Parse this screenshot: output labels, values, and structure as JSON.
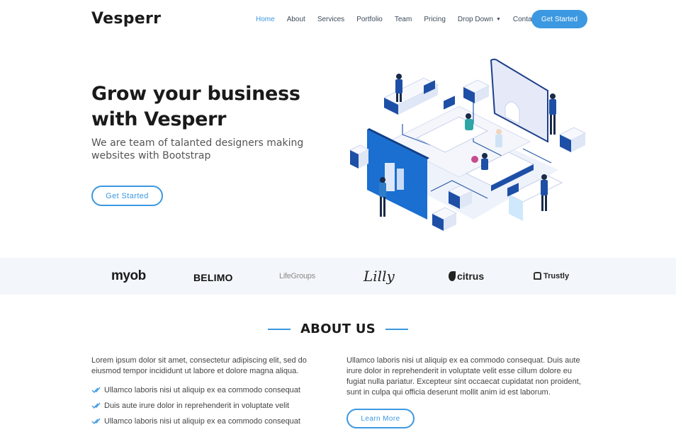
{
  "brand": {
    "name": "Vesperr"
  },
  "nav": {
    "items": [
      {
        "label": "Home",
        "active": true
      },
      {
        "label": "About"
      },
      {
        "label": "Services"
      },
      {
        "label": "Portfolio"
      },
      {
        "label": "Team"
      },
      {
        "label": "Pricing"
      },
      {
        "label": "Drop Down",
        "has_dropdown": true
      },
      {
        "label": "Contact"
      }
    ],
    "cta_label": "Get Started"
  },
  "hero": {
    "title": "Grow your business with Vesperr",
    "subtitle": "We are team of talanted designers making websites with Bootstrap",
    "button_label": "Get Started",
    "illustration": "isometric-office-illustration"
  },
  "clients": [
    {
      "name": "myob"
    },
    {
      "name": "BELIMO"
    },
    {
      "name": "LifeGroups"
    },
    {
      "name": "Lilly"
    },
    {
      "name": "citrus"
    },
    {
      "name": "Trustly"
    }
  ],
  "about": {
    "title": "ABOUT US",
    "intro": "Lorem ipsum dolor sit amet, consectetur adipiscing elit, sed do eiusmod tempor incididunt ut labore et dolore magna aliqua.",
    "list": [
      "Ullamco laboris nisi ut aliquip ex ea commodo consequat",
      "Duis aute irure dolor in reprehenderit in voluptate velit",
      "Ullamco laboris nisi ut aliquip ex ea commodo consequat"
    ],
    "right_text": "Ullamco laboris nisi ut aliquip ex ea commodo consequat. Duis aute irure dolor in reprehenderit in voluptate velit esse cillum dolore eu fugiat nulla pariatur. Excepteur sint occaecat cupidatat non proident, sunt in culpa qui officia deserunt mollit anim id est laborum.",
    "button_label": "Learn More"
  },
  "colors": {
    "accent": "#3c98e0",
    "heading": "#1a1a1a",
    "clients_bg": "#f3f7fb"
  },
  "icons": {
    "list_bullet": "double-check-icon",
    "dropdown": "chevron-down-icon"
  }
}
